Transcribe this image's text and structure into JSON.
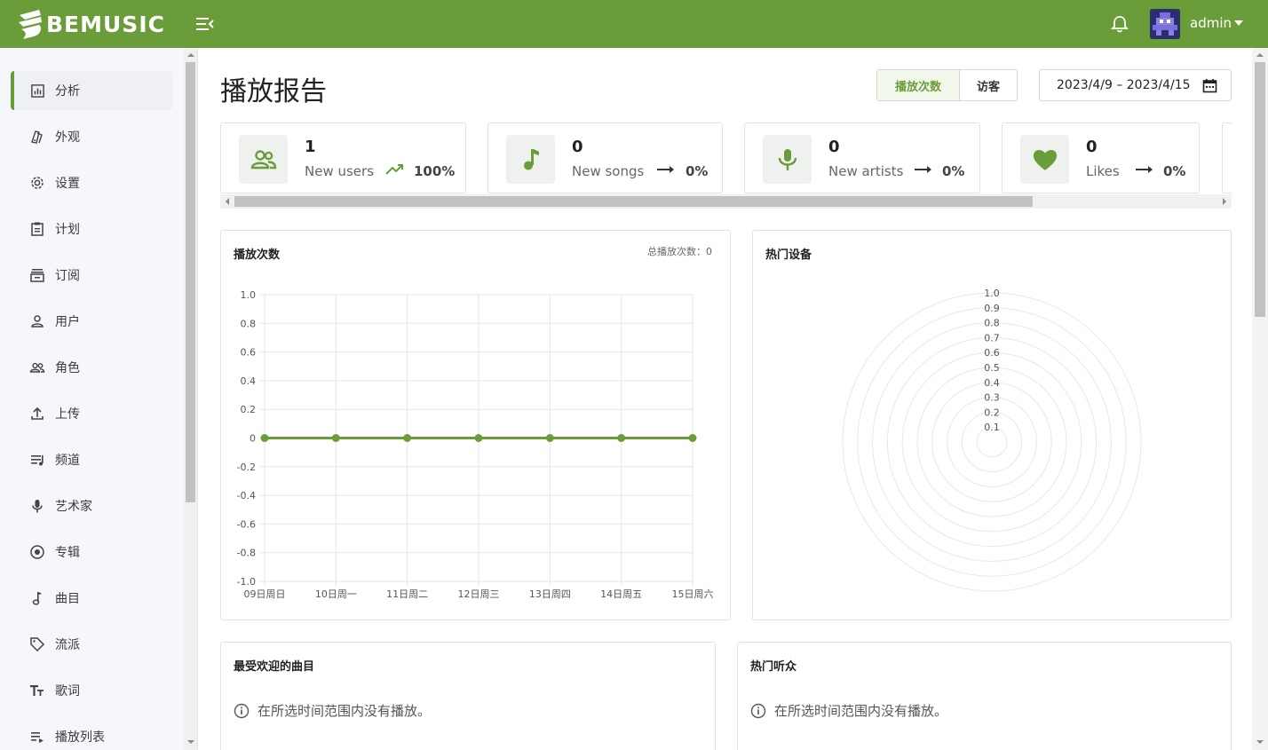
{
  "app": {
    "brand": "BEMUSIC",
    "user": "admin"
  },
  "colors": {
    "accent": "#6a9d3a",
    "topbar": "#6a9d3a"
  },
  "sidebar": {
    "items": [
      {
        "label": "分析",
        "icon": "analytics-icon",
        "active": true
      },
      {
        "label": "外观",
        "icon": "palette-icon"
      },
      {
        "label": "设置",
        "icon": "gear-icon"
      },
      {
        "label": "计划",
        "icon": "clipboard-icon"
      },
      {
        "label": "订阅",
        "icon": "subscription-icon"
      },
      {
        "label": "用户",
        "icon": "user-icon"
      },
      {
        "label": "角色",
        "icon": "people-icon"
      },
      {
        "label": "上传",
        "icon": "upload-icon"
      },
      {
        "label": "频道",
        "icon": "channel-icon"
      },
      {
        "label": "艺术家",
        "icon": "mic-icon"
      },
      {
        "label": "专辑",
        "icon": "album-icon"
      },
      {
        "label": "曲目",
        "icon": "music-note-icon"
      },
      {
        "label": "流派",
        "icon": "tag-icon"
      },
      {
        "label": "歌词",
        "icon": "text-icon"
      },
      {
        "label": "播放列表",
        "icon": "playlist-icon"
      }
    ]
  },
  "header": {
    "title": "播放报告",
    "toggle": {
      "plays": "播放次数",
      "visitors": "访客"
    },
    "date_range": "2023/4/9 – 2023/4/15"
  },
  "stats": [
    {
      "value": "1",
      "label": "New users",
      "pct": "100%",
      "trend": "up",
      "icon": "users-icon"
    },
    {
      "value": "0",
      "label": "New songs",
      "pct": "0%",
      "trend": "flat",
      "icon": "music-note-icon"
    },
    {
      "value": "0",
      "label": "New artists",
      "pct": "0%",
      "trend": "flat",
      "icon": "mic-icon"
    },
    {
      "value": "0",
      "label": "Likes",
      "pct": "0%",
      "trend": "flat",
      "icon": "heart-icon"
    }
  ],
  "plays_panel": {
    "title": "播放次数",
    "total": "总播放次数：0"
  },
  "devices_panel": {
    "title": "热门设备"
  },
  "top_tracks": {
    "title": "最受欢迎的曲目",
    "empty": "在所选时间范围内没有播放。"
  },
  "top_listeners": {
    "title": "热门听众",
    "empty": "在所选时间范围内没有播放。"
  },
  "chart_data": [
    {
      "type": "line",
      "categories": [
        "09日周日",
        "10日周一",
        "11日周二",
        "12日周三",
        "13日周四",
        "14日周五",
        "15日周六"
      ],
      "series": [
        {
          "values": [
            0,
            0,
            0,
            0,
            0,
            0,
            0
          ]
        }
      ],
      "yticks": [
        "1.0",
        "0.8",
        "0.6",
        "0.4",
        "0.2",
        "0",
        "-0.2",
        "-0.4",
        "-0.6",
        "-0.8",
        "-1.0"
      ],
      "ylim": [
        -1.0,
        1.0
      ],
      "grid": true
    },
    {
      "type": "radar",
      "rticks": [
        "1.0",
        "0.9",
        "0.8",
        "0.7",
        "0.6",
        "0.5",
        "0.4",
        "0.3",
        "0.2",
        "0.1"
      ],
      "rlim": [
        0,
        1.0
      ]
    }
  ]
}
